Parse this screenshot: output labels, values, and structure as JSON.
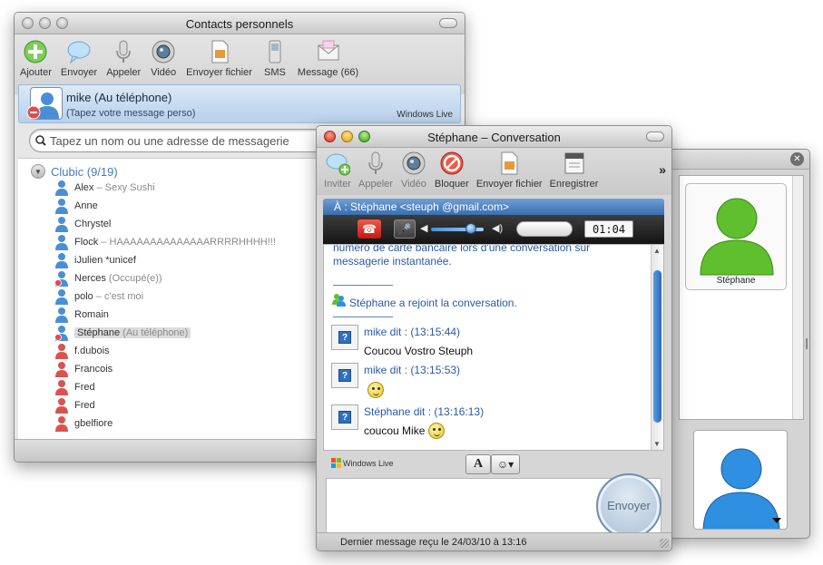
{
  "contacts_window": {
    "title": "Contacts personnels",
    "toolbar": [
      {
        "label": "Ajouter",
        "icon": "add-icon"
      },
      {
        "label": "Envoyer",
        "icon": "speech-bubble-icon"
      },
      {
        "label": "Appeler",
        "icon": "microphone-icon"
      },
      {
        "label": "Vidéo",
        "icon": "webcam-icon"
      },
      {
        "label": "Envoyer fichier",
        "icon": "file-icon"
      },
      {
        "label": "SMS",
        "icon": "phone-icon"
      },
      {
        "label": "Message (66)",
        "icon": "envelope-icon"
      }
    ],
    "profile": {
      "name": "mike (Au téléphone)",
      "personal_message": "(Tapez votre message perso)",
      "brand": "Windows Live"
    },
    "search_placeholder": "Tapez un nom ou une adresse de messagerie",
    "group": {
      "name": "Clubic (9/19)"
    },
    "contacts": [
      {
        "name": "Alex",
        "status": "– Sexy Sushi",
        "color": "blue"
      },
      {
        "name": "Anne",
        "status": "",
        "color": "blue"
      },
      {
        "name": "Chrystel",
        "status": "",
        "color": "blue"
      },
      {
        "name": "Flock",
        "status": "– HAAAAAAAAAAAAAARRRRHHHH!!!",
        "color": "blue"
      },
      {
        "name": "iJulien *unicef",
        "status": "",
        "color": "blue"
      },
      {
        "name": "Nerces",
        "status": "(Occupé(e))",
        "color": "blue-busy"
      },
      {
        "name": "polo",
        "status": "– c'est moi",
        "color": "blue"
      },
      {
        "name": "Romain",
        "status": "",
        "color": "blue"
      },
      {
        "name": "Stéphane",
        "status": "(Au téléphone)",
        "color": "blue-busy",
        "selected": true
      },
      {
        "name": "f.dubois",
        "status": "",
        "color": "red"
      },
      {
        "name": "Francois",
        "status": "",
        "color": "red"
      },
      {
        "name": "Fred",
        "status": "",
        "color": "red"
      },
      {
        "name": "Fred",
        "status": "",
        "color": "red"
      },
      {
        "name": "gbelfiore",
        "status": "",
        "color": "red"
      }
    ]
  },
  "conversation_window": {
    "title": "Stéphane – Conversation",
    "toolbar": [
      {
        "label": "Inviter",
        "icon": "invite-icon"
      },
      {
        "label": "Appeler",
        "icon": "microphone-icon"
      },
      {
        "label": "Vidéo",
        "icon": "webcam-icon"
      },
      {
        "label": "Bloquer",
        "icon": "block-icon"
      },
      {
        "label": "Envoyer fichier",
        "icon": "file-icon"
      },
      {
        "label": "Enregistrer",
        "icon": "save-icon"
      }
    ],
    "more_label": "»",
    "to_line": "À : Stéphane <steuph        @gmail.com>",
    "call": {
      "timer": "01:04",
      "volume": 0.75
    },
    "messages": {
      "warning": "numéro de carte bancaire lors d'une conversation sur messagerie instantanée.",
      "joined": "Stéphane a rejoint la conversation.",
      "entries": [
        {
          "sender": "mike dit : (13:15:44)",
          "text": "Coucou Vostro Steuph",
          "smiley": false
        },
        {
          "sender": "mike dit : (13:15:53)",
          "text": "",
          "smiley": true
        },
        {
          "sender": "Stéphane dit : (13:16:13)",
          "text": "coucou Mike",
          "smiley": true
        }
      ]
    },
    "format_brand": "Windows Live",
    "font_button": "A",
    "send_label": "Envoyer",
    "footer": "Dernier message reçu le 24/03/10 à 13:16"
  },
  "side_panel": {
    "contact_card": {
      "name": "Stéphane"
    }
  },
  "colors": {
    "link_blue": "#2b58a7",
    "accent_blue": "#3a6eb0",
    "group_blue": "#4a78b8"
  }
}
